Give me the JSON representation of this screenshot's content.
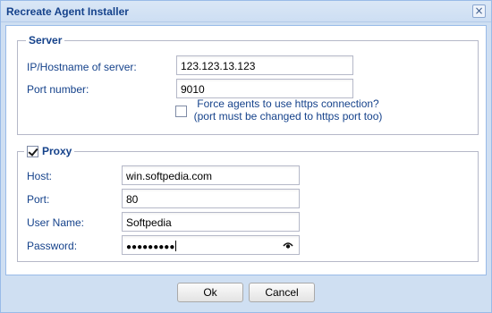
{
  "window": {
    "title": "Recreate Agent Installer",
    "close_glyph": "×"
  },
  "server": {
    "legend": "Server",
    "host_label": "IP/Hostname of server:",
    "host_value": "123.123.13.123",
    "port_label": "Port number:",
    "port_value": "9010",
    "https_checked": false,
    "https_note_line1": "Force agents to use https connection?",
    "https_note_line2": "(port must be changed to https port too)"
  },
  "proxy": {
    "legend": "Proxy",
    "enabled": true,
    "host_label": "Host:",
    "host_value": "win.softpedia.com",
    "port_label": "Port:",
    "port_value": "80",
    "user_label": "User Name:",
    "user_value": "Softpedia",
    "password_label": "Password:",
    "password_masked": "●●●●●●●●●",
    "show_password_icon": "eye-icon"
  },
  "buttons": {
    "ok": "Ok",
    "cancel": "Cancel"
  },
  "colors": {
    "accent": "#15428b",
    "frame": "#cfdff2",
    "border": "#99bbe8"
  }
}
